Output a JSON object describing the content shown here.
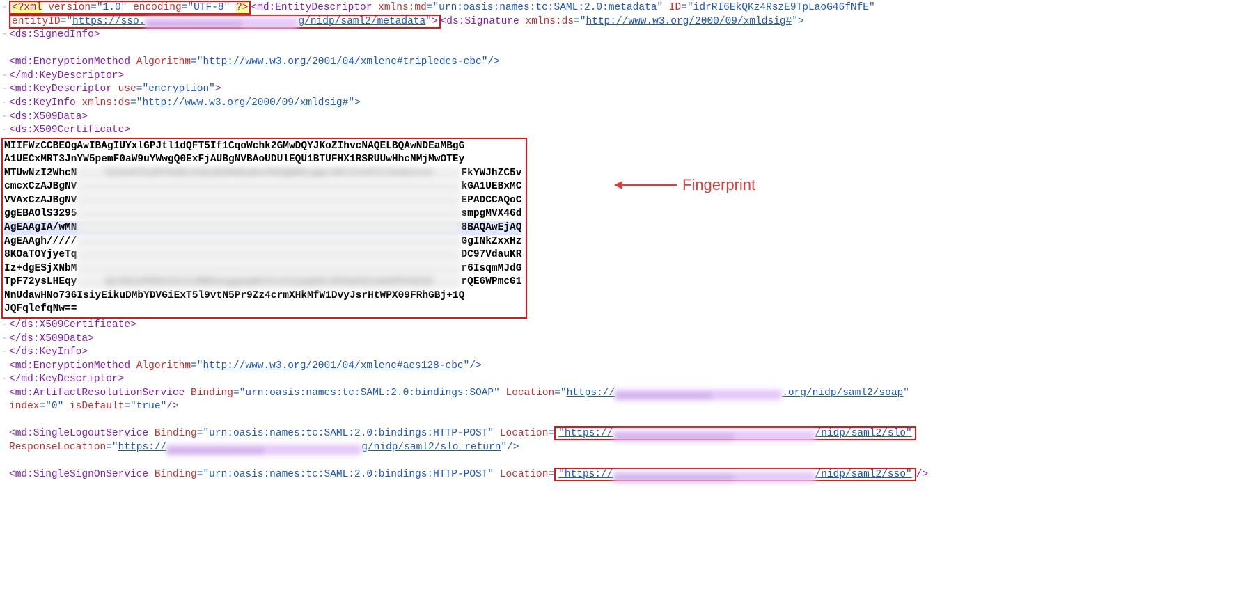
{
  "annotation": {
    "label": "Fingerprint"
  },
  "xml_decl": {
    "open": "<?xml",
    "v_attr": "version",
    "v_val": "\"1.0\"",
    "e_attr": "encoding",
    "e_val": "\"UTF-8\"",
    "close": "?>"
  },
  "entity": {
    "tag_open": "<md:EntityDescriptor",
    "ns_attr": "xmlns:md",
    "ns_val": "\"urn:oasis:names:tc:SAML:2.0:metadata\"",
    "id_attr": "ID",
    "id_val": "\"idrRI6EkQKz4RszE9TpLaoG46fNfE\"",
    "eid_attr": "entityID",
    "eid_q": "\"",
    "eid_pre": "https://sso.",
    "eid_blur": "smartcitymoradabad.or",
    "eid_post": "g/nidp/saml2/metadata",
    "close": ">"
  },
  "sig": {
    "tag_open": "<ds:Signature",
    "ns_attr": "xmlns:ds",
    "q": "=\"",
    "ns_val": "http://www.w3.org/2000/09/xmldsig#",
    "close": "\">"
  },
  "signed_info": "<ds:SignedInfo>",
  "enc1": {
    "tag_open": "<md:EncryptionMethod",
    "alg_attr": "Algorithm",
    "q": "=\"",
    "alg_val": "http://www.w3.org/2001/04/xmlenc#tripledes-cbc",
    "close": "\"/>"
  },
  "close_keydesc": "</md:KeyDescriptor>",
  "keydesc2": {
    "tag_open": "<md:KeyDescriptor",
    "use_attr": "use",
    "use_val": "=\"encryption\"",
    "close": ">"
  },
  "keyinfo": {
    "tag_open": "<ds:KeyInfo",
    "ns_attr": "xmlns:ds",
    "q": "=\"",
    "ns_val": "http://www.w3.org/2000/09/xmldsig#",
    "close": "\">"
  },
  "x509data_open": "<ds:X509Data>",
  "x509cert_open": "<ds:X509Certificate>",
  "cert": {
    "l1": "MIIFWzCCBEOgAwIBAgIUYxlGPJtl1dQFT5If1CqoWchk2GMwDQYJKoZIhvcNAQELBQAwNDEaMBgG",
    "l2": "A1UECxMRT3JnYW5pemF0aW9uYWwgQ0ExFjAUBgNVBAoUDUlEQU1BTUFHX1RSRUUwHhcNMjMwOTEy",
    "l3_a": "MTUwNzI2WhcN",
    "l3_blur": "MjUwOTEyMTUwNzI2WjB2MSEwHwYDVQQDExggLnNtYXJ0Y2l0eW1vcm",
    "l3_b": "FkYWJhZC5v",
    "l4_a": "cmcxCzAJBgNV",
    "l4_b": "kGA1UEBxMC",
    "l5_a": "VVAxCzAJBgNV",
    "l5_b": "EPADCCAQoC",
    "l6_a": "ggEBAOlS3295",
    "l6_b": "smpgMVX46d",
    "l7_a": "AgEAAgIA/wMN",
    "l7_b": "8BAQAwEjAQ",
    "l8_a": "AgEAAgh/////",
    "l8_b": "GgINkZxxHz",
    "l9_a": "8KOaTOYjyeTq",
    "l9_b": "DC97VdauKR",
    "l10_a": "Iz+dgESjXNbM",
    "l10_b": "r6IsqmMJdG",
    "l11_a": "TpF72ysLHEqy",
    "l11_blur": "Qe3D2wPN9hIUIIsMBEmsggaqWhIVxIhIpgG8LGPOq5OIwOOdPO3OIN",
    "l11_b": "rQE6WPmcG1",
    "l12": "NnUdawHNo736IsiyEikuDMbYDVGiExT5l9vtN5Pr9Zz4crmXHkMfW1DvyJsrHtWPX09FRhGBj+1Q",
    "l13": "JQFqlefqNw=="
  },
  "x509cert_close": "</ds:X509Certificate>",
  "x509data_close": "</ds:X509Data>",
  "keyinfo_close": "</ds:KeyInfo>",
  "enc2": {
    "tag_open": "<md:EncryptionMethod",
    "alg_attr": "Algorithm",
    "q": "=\"",
    "alg_val": "http://www.w3.org/2001/04/xmlenc#aes128-cbc",
    "close": "\"/>"
  },
  "ars": {
    "tag_open": "<md:ArtifactResolutionService",
    "bind_attr": "Binding",
    "bind_val": "=\"urn:oasis:names:tc:SAML:2.0:bindings:SOAP\"",
    "loc_attr": "Location",
    "q": "=\"",
    "loc_pre": "https://",
    "loc_post": ".org/nidp/saml2/soap",
    "qe": "\"",
    "idx_attr": "index",
    "idx_val": "=\"0\"",
    "def_attr": "isDefault",
    "def_val": "=\"true\"",
    "close": "/>"
  },
  "slo": {
    "tag_open": "<md:SingleLogoutService",
    "bind_attr": "Binding",
    "bind_val": "=\"urn:oasis:names:tc:SAML:2.0:bindings:HTTP-POST\"",
    "loc_attr": "Location",
    "loc_q": "=",
    "loc_pre": "\"https://",
    "loc_post": "/nidp/saml2/slo\"",
    "resp_attr": "ResponseLocation",
    "resp_q": "=\"",
    "resp_pre": "https://",
    "resp_post": "g/nidp/saml2/slo_return",
    "resp_close": "\"/>"
  },
  "sso": {
    "tag_open": "<md:SingleSignOnService",
    "bind_attr": "Binding",
    "bind_val": "=\"urn:oasis:names:tc:SAML:2.0:bindings:HTTP-POST\"",
    "loc_attr": "Location",
    "loc_q": "=",
    "loc_pre": "\"https://",
    "loc_post": "/nidp/saml2/sso\"",
    "close": "/>"
  }
}
